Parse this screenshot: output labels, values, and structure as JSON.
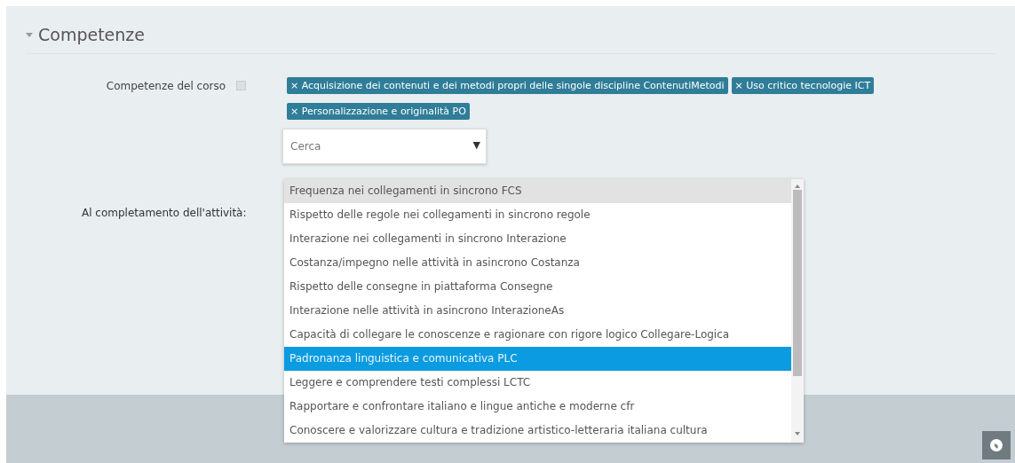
{
  "section": {
    "title": "Competenze",
    "expanded": true
  },
  "course_competencies": {
    "label": "Competenze del corso",
    "tags": [
      {
        "remove": "×",
        "text": "Acquisizione dei contenuti e dei metodi propri delle singole discipline ContenutiMetodi"
      },
      {
        "remove": "×",
        "text": "Uso critico tecnologie ICT"
      },
      {
        "remove": "×",
        "text": "Personalizzazione e originalità PO"
      }
    ],
    "search": {
      "placeholder": "Cerca",
      "caret": "▼"
    }
  },
  "completion": {
    "label": "Al completamento dell'attività:"
  },
  "options": [
    {
      "text": "Frequenza nei collegamenti in sincrono FCS",
      "hovered": true,
      "selected": false
    },
    {
      "text": "Rispetto delle regole nei collegamenti in sincrono regole",
      "hovered": false,
      "selected": false
    },
    {
      "text": "Interazione nei collegamenti in sincrono Interazione",
      "hovered": false,
      "selected": false
    },
    {
      "text": "Costanza/impegno nelle attività in asincrono Costanza",
      "hovered": false,
      "selected": false
    },
    {
      "text": "Rispetto delle consegne in piattaforma Consegne",
      "hovered": false,
      "selected": false
    },
    {
      "text": "Interazione nelle attività in asincrono InterazioneAs",
      "hovered": false,
      "selected": false
    },
    {
      "text": "Capacità di collegare le conoscenze e ragionare con rigore logico Collegare-Logica",
      "hovered": false,
      "selected": false
    },
    {
      "text": "Padronanza linguistica e comunicativa PLC",
      "hovered": false,
      "selected": true
    },
    {
      "text": "Leggere e comprendere testi complessi LCTC",
      "hovered": false,
      "selected": false
    },
    {
      "text": "Rapportare e confrontare italiano e lingue antiche e moderne cfr",
      "hovered": false,
      "selected": false
    },
    {
      "text": "Conoscere e valorizzare cultura e tradizione artistico-letteraria italiana cultura",
      "hovered": false,
      "selected": false
    }
  ]
}
